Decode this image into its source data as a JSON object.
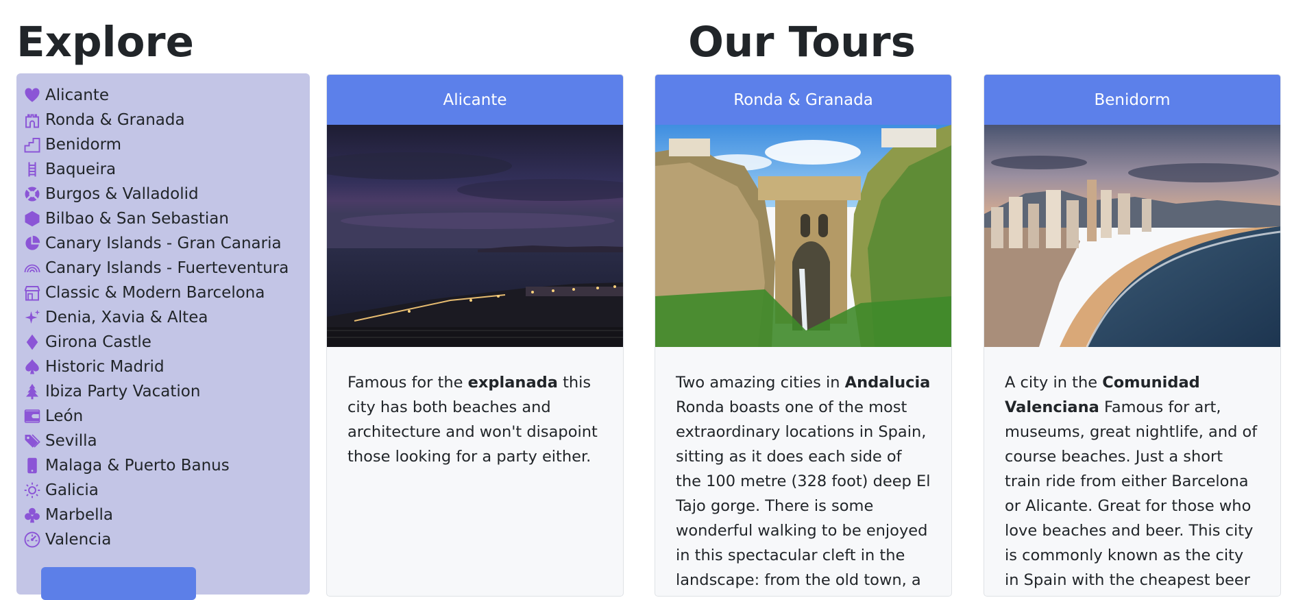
{
  "explore": {
    "title": "Explore",
    "items": [
      {
        "label": "Alicante",
        "icon": "heart-icon"
      },
      {
        "label": "Ronda & Granada",
        "icon": "castle-icon"
      },
      {
        "label": "Benidorm",
        "icon": "buildings-icon"
      },
      {
        "label": "Baqueira",
        "icon": "ladder-icon"
      },
      {
        "label": "Burgos & Valladolid",
        "icon": "life-ring-icon"
      },
      {
        "label": "Bilbao & San Sebastian",
        "icon": "hexagon-icon"
      },
      {
        "label": "Canary Islands - Gran Canaria",
        "icon": "pie-chart-icon"
      },
      {
        "label": "Canary Islands - Fuerteventura",
        "icon": "rainbow-icon"
      },
      {
        "label": "Classic & Modern Barcelona",
        "icon": "shop-icon"
      },
      {
        "label": "Denia, Xavia & Altea",
        "icon": "stars-icon"
      },
      {
        "label": "Girona Castle",
        "icon": "diamond-icon"
      },
      {
        "label": "Historic Madrid",
        "icon": "spade-icon"
      },
      {
        "label": "Ibiza Party Vacation",
        "icon": "tree-icon"
      },
      {
        "label": "León",
        "icon": "wallet-icon"
      },
      {
        "label": "Sevilla",
        "icon": "tags-icon"
      },
      {
        "label": "Malaga & Puerto Banus",
        "icon": "phone-icon"
      },
      {
        "label": "Galicia",
        "icon": "sun-icon"
      },
      {
        "label": "Marbella",
        "icon": "club-icon"
      },
      {
        "label": "Valencia",
        "icon": "speedometer-icon"
      }
    ]
  },
  "tours": {
    "title": "Our Tours",
    "cards": [
      {
        "header": "Alicante",
        "image": "Alicante harbour at dusk",
        "text_pre": "Famous for the ",
        "text_bold": "explanada",
        "text_post": " this city has both beaches and architecture and won't disapoint those looking for a party either."
      },
      {
        "header": "Ronda & Granada",
        "image": "Ronda bridge over the gorge",
        "text_pre": "Two amazing cities in ",
        "text_bold": "Andalucia",
        "text_post": " Ronda boasts one of the most extraordinary locations in Spain, sitting as it does each side of the 100 metre (328 foot) deep El Tajo gorge. There is some wonderful walking to be enjoyed in this spectacular cleft in the landscape: from the old town, a dramatic path"
      },
      {
        "header": "Benidorm",
        "image": "Benidorm beach at sunset",
        "text_pre": "A city in the ",
        "text_bold": "Comunidad Valenciana",
        "text_post": " Famous for art, museums, great nightlife, and of course beaches. Just a short train ride from either Barcelona or Alicante. Great for those who love beaches and beer. This city is commonly known as the city in Spain with the cheapest beer"
      }
    ]
  },
  "colors": {
    "card_header": "#5c80ea",
    "sidebar_bg": "#c3c5e6",
    "icon": "#8b55d6"
  }
}
